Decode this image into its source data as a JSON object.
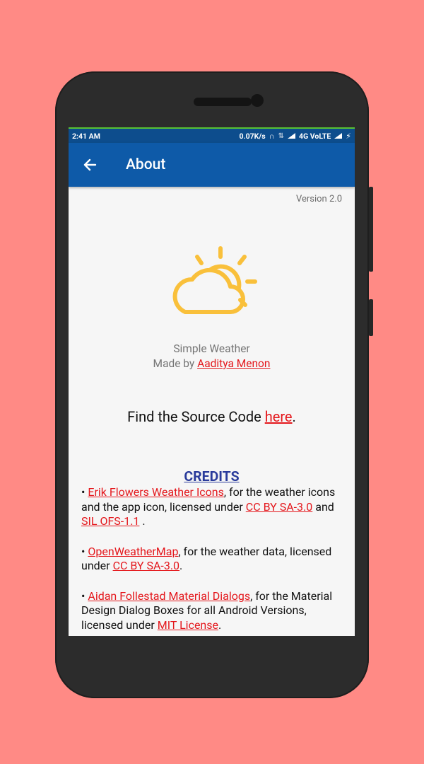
{
  "status_bar": {
    "time": "2:41 AM",
    "net_speed": "0.07K/s",
    "network": "4G VoLTE"
  },
  "app_bar": {
    "title": "About"
  },
  "version": "Version 2.0",
  "app_info": {
    "name": "Simple Weather",
    "made_by_prefix": "Made by ",
    "author": "Aaditya Menon"
  },
  "source": {
    "prefix": "Find the Source Code ",
    "link": "here",
    "suffix": "."
  },
  "credits": {
    "title": "CREDITS",
    "items": [
      {
        "bullet": "• ",
        "link": "Erik Flowers Weather Icons",
        "text1": ", for the weather icons and the app icon, licensed under ",
        "license1": "CC BY SA-3.0",
        "text2": " and ",
        "license2": "SIL OFS-1.1",
        "text3": " ."
      },
      {
        "bullet": "• ",
        "link": "OpenWeatherMap",
        "text1": ", for the weather data, licensed under ",
        "license1": "CC BY SA-3.0",
        "text2": "."
      },
      {
        "bullet": "• ",
        "link": "Aidan Follestad Material Dialogs",
        "text1": ", for the Material Design Dialog Boxes for all Android Versions, licensed under ",
        "license1": "MIT License",
        "text2": "."
      }
    ]
  },
  "colors": {
    "background": "#ff8a85",
    "app_bar": "#0e5aa8",
    "link": "#e4171c",
    "credits_title": "#2a3b9b",
    "logo": "#f9c03b"
  }
}
